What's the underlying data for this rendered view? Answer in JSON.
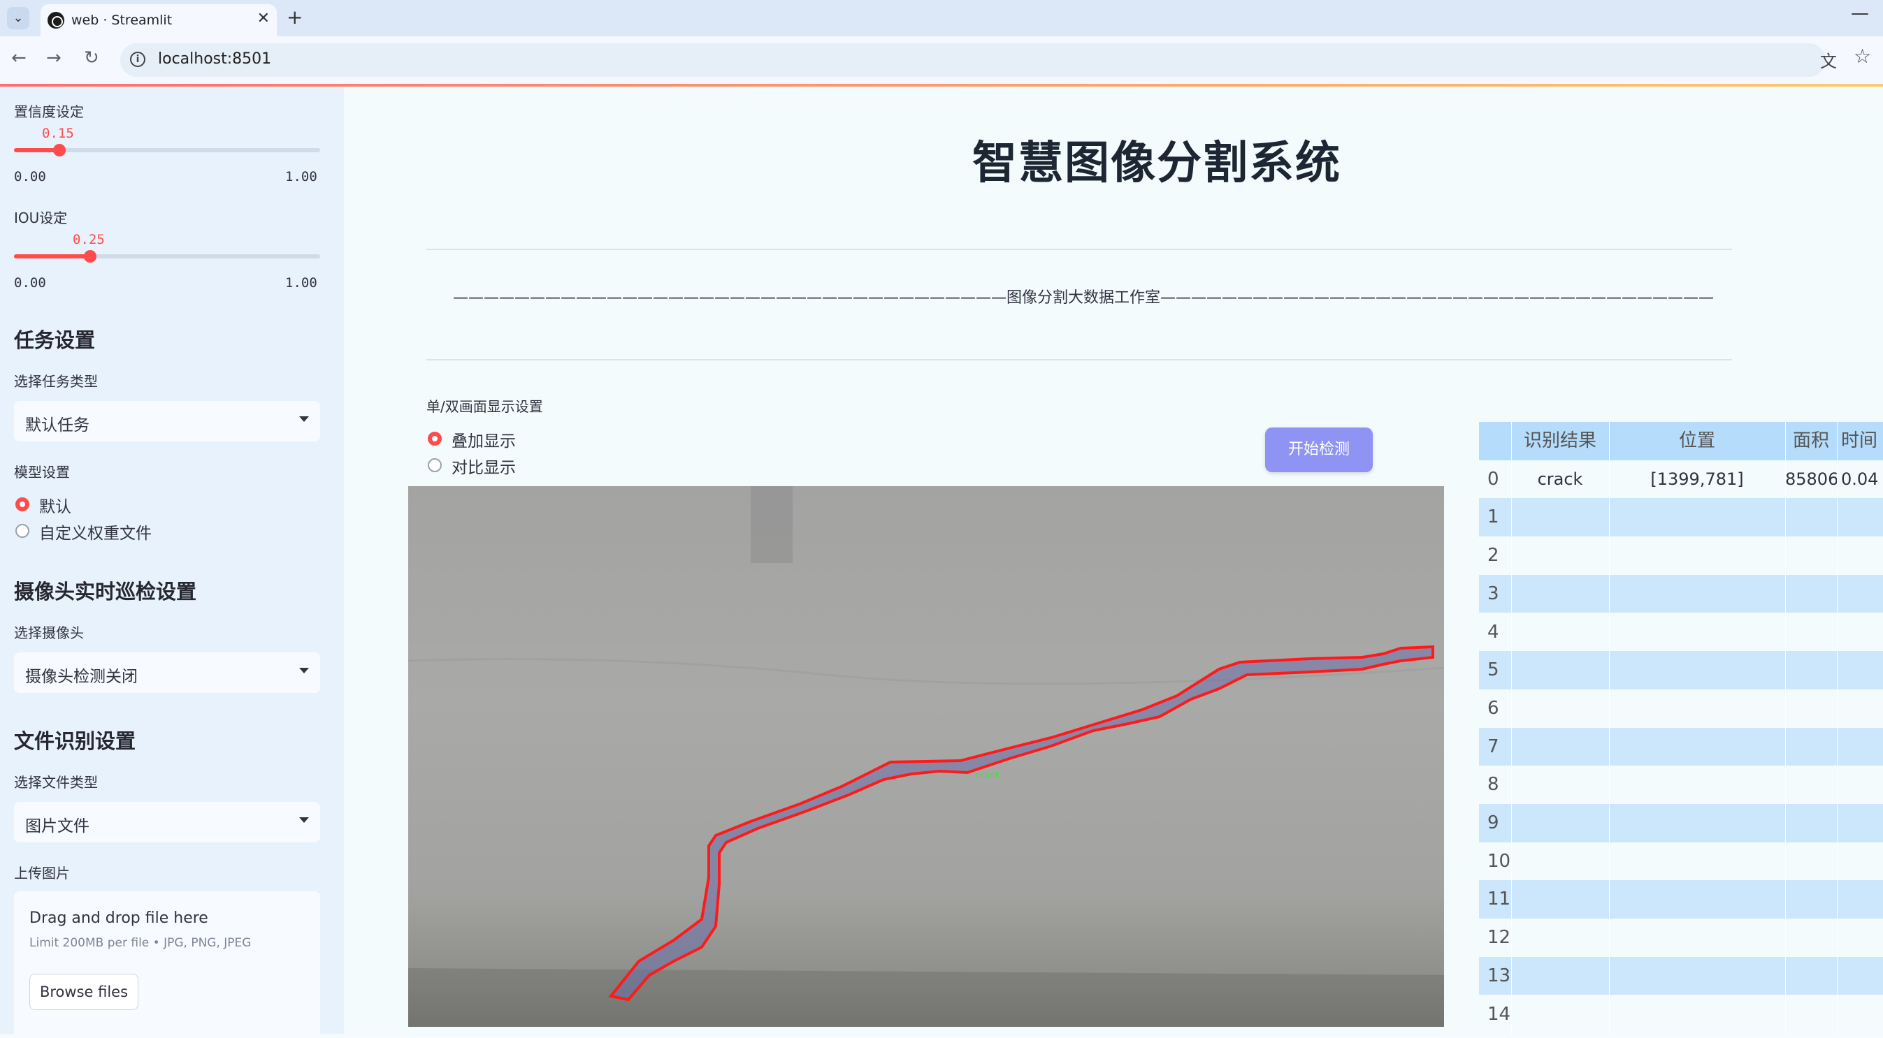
{
  "browser": {
    "tab_title": "web · Streamlit",
    "url": "localhost:8501"
  },
  "sidebar": {
    "confidence": {
      "label": "置信度设定",
      "value": "0.15",
      "min": "0.00",
      "max": "1.00",
      "fraction": 0.15
    },
    "iou": {
      "label": "IOU设定",
      "value": "0.25",
      "min": "0.00",
      "max": "1.00",
      "fraction": 0.25
    },
    "task_header": "任务设置",
    "task_type_label": "选择任务类型",
    "task_type_value": "默认任务",
    "model_label": "模型设置",
    "model_options": [
      "默认",
      "自定义权重文件"
    ],
    "model_selected": "默认",
    "camera_header": "摄像头实时巡检设置",
    "camera_label": "选择摄像头",
    "camera_value": "摄像头检测关闭",
    "file_header": "文件识别设置",
    "file_type_label": "选择文件类型",
    "file_type_value": "图片文件",
    "upload_label": "上传图片",
    "upload_title": "Drag and drop file here",
    "upload_limit": "Limit 200MB per file • JPG, PNG, JPEG",
    "upload_button": "Browse files"
  },
  "main": {
    "title": "智慧图像分割系统",
    "banner": "————————————————————————————————————图像分割大数据工作室————————————————————————————————————",
    "display_label": "单/双画面显示设置",
    "display_options": [
      "叠加显示",
      "对比显示"
    ],
    "display_selected": "叠加显示",
    "start_button": "开始检测",
    "detection_label": "crack"
  },
  "table": {
    "columns": [
      "识别结果",
      "位置",
      "面积",
      "时间"
    ],
    "rows": [
      {
        "index": "0",
        "class": "crack",
        "position": "[1399,781]",
        "area": "85806",
        "time": "0.04"
      },
      {
        "index": "1"
      },
      {
        "index": "2"
      },
      {
        "index": "3"
      },
      {
        "index": "4"
      },
      {
        "index": "5"
      },
      {
        "index": "6"
      },
      {
        "index": "7"
      },
      {
        "index": "8"
      },
      {
        "index": "9"
      },
      {
        "index": "10"
      },
      {
        "index": "11"
      },
      {
        "index": "12"
      },
      {
        "index": "13"
      },
      {
        "index": "14"
      }
    ]
  },
  "colors": {
    "accent": "#ff4b4b",
    "button": "#8f93f4",
    "table_header": "#b6dcfb",
    "table_alt": "#cce6fb",
    "mask_outline": "#ff1a1a"
  }
}
